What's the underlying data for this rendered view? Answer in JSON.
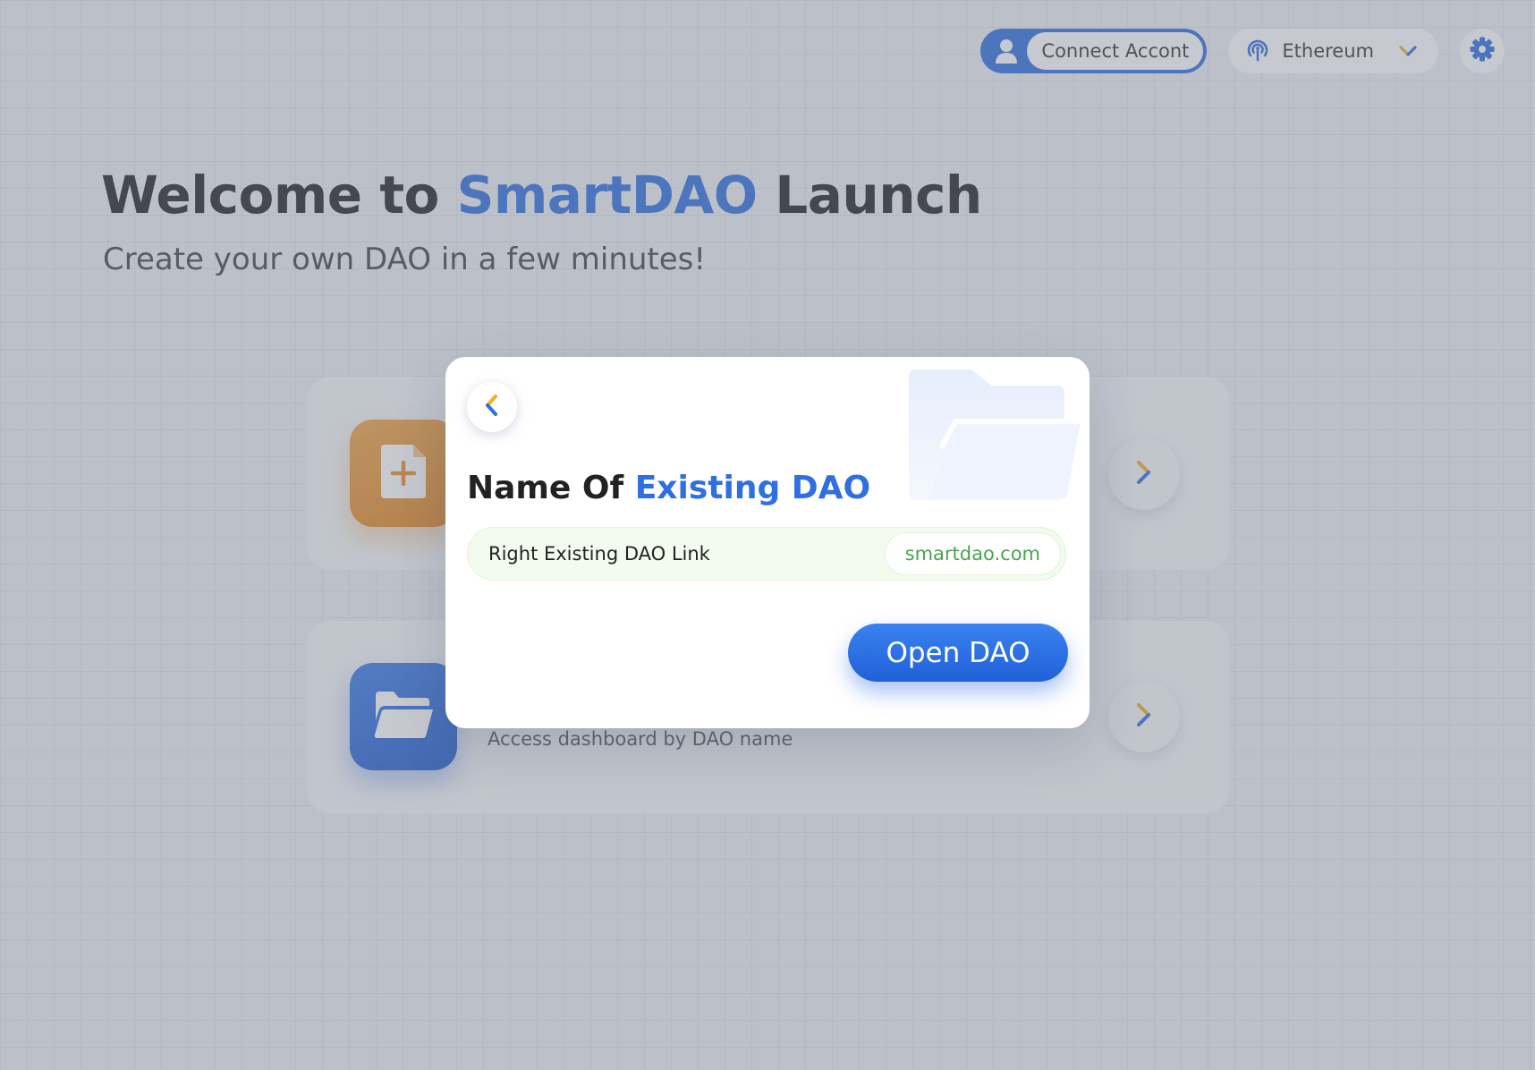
{
  "header": {
    "connect_label": "Connect Accont",
    "network_label": "Ethereum"
  },
  "hero": {
    "title_prefix": "Welcome to ",
    "title_brand": "SmartDAO",
    "title_suffix": " Launch",
    "subtitle": "Create your own DAO in a few minutes!"
  },
  "cards": [
    {
      "icon": "file-plus-icon",
      "description": ""
    },
    {
      "icon": "folder-open-icon",
      "description": "Access dashboard by DAO name"
    }
  ],
  "modal": {
    "title_prefix": "Name Of ",
    "title_accent": "Existing DAO",
    "link_placeholder": "Right Existing DAO Link",
    "link_value": "",
    "domain_suffix": "smartdao.com",
    "open_label": "Open DAO"
  },
  "colors": {
    "accent": "#2f6fe0",
    "orange": "#e8922c",
    "green_text": "#4aa44f",
    "chevron_yellow": "#f2b01e"
  }
}
